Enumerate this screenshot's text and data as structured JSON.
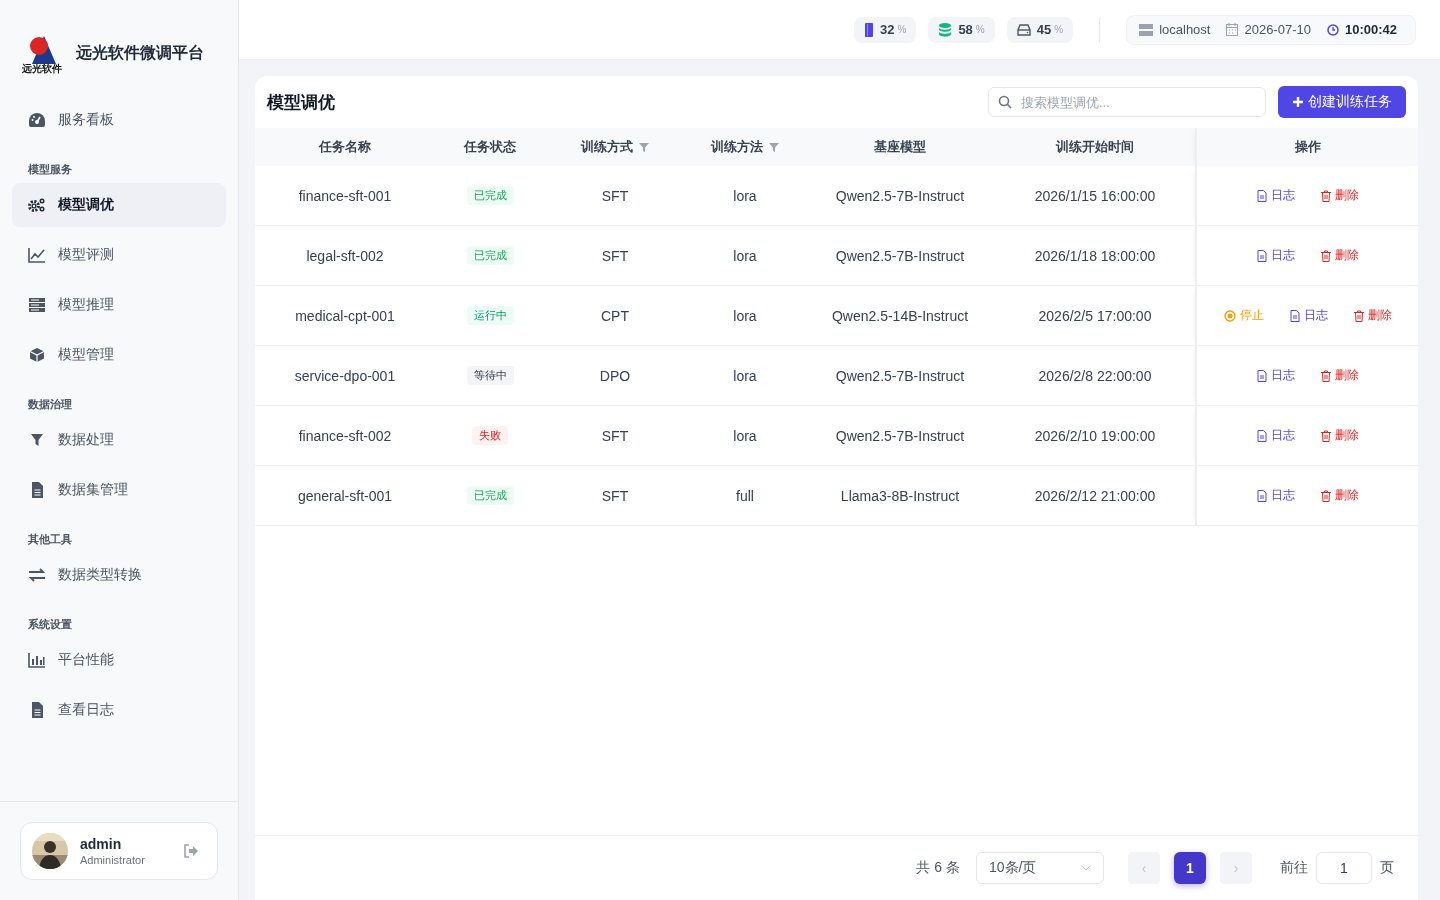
{
  "sidebar": {
    "logo_text": "远光软件",
    "title": "远光软件微调平台",
    "nav": [
      {
        "kind": "item",
        "label": "服务看板",
        "selected": false
      },
      {
        "kind": "heading",
        "label": "模型服务"
      },
      {
        "kind": "item",
        "label": "模型调优",
        "selected": true
      },
      {
        "kind": "item",
        "label": "模型评测",
        "selected": false
      },
      {
        "kind": "item",
        "label": "模型推理",
        "selected": false
      },
      {
        "kind": "item",
        "label": "模型管理",
        "selected": false
      },
      {
        "kind": "heading",
        "label": "数据治理"
      },
      {
        "kind": "item",
        "label": "数据处理",
        "selected": false
      },
      {
        "kind": "item",
        "label": "数据集管理",
        "selected": false
      },
      {
        "kind": "heading",
        "label": "其他工具"
      },
      {
        "kind": "item",
        "label": "数据类型转换",
        "selected": false
      },
      {
        "kind": "heading",
        "label": "系统设置"
      },
      {
        "kind": "item",
        "label": "平台性能",
        "selected": false
      },
      {
        "kind": "item",
        "label": "查看日志",
        "selected": false
      }
    ],
    "user": {
      "name": "admin",
      "role": "Administrator"
    }
  },
  "topbar": {
    "stats": [
      {
        "value": "32",
        "unit": "%"
      },
      {
        "value": "58",
        "unit": "%"
      },
      {
        "value": "45",
        "unit": "%"
      }
    ],
    "host": "localhost",
    "date": "2026-07-10",
    "time": "10:00:42"
  },
  "main": {
    "title": "模型调优",
    "search": {
      "placeholder": "搜索模型调优..."
    },
    "create_button": "创建训练任务",
    "table": {
      "columns": [
        {
          "label": "任务名称",
          "filter": false
        },
        {
          "label": "任务状态",
          "filter": false
        },
        {
          "label": "训练方式",
          "filter": true
        },
        {
          "label": "训练方法",
          "filter": true
        },
        {
          "label": "基座模型",
          "filter": false
        },
        {
          "label": "训练开始时间",
          "filter": false
        },
        {
          "label": "操作",
          "filter": false
        }
      ],
      "rows": [
        {
          "name": "finance-sft-001",
          "status": {
            "text": "已完成",
            "kind": "done"
          },
          "mode": "SFT",
          "method": "lora",
          "model": "Qwen2.5-7B-Instruct",
          "start": "2026/1/15 16:00:00",
          "actions": [
            {
              "kind": "log",
              "label": "日志"
            },
            {
              "kind": "delete",
              "label": "删除"
            }
          ]
        },
        {
          "name": "legal-sft-002",
          "status": {
            "text": "已完成",
            "kind": "done"
          },
          "mode": "SFT",
          "method": "lora",
          "model": "Qwen2.5-7B-Instruct",
          "start": "2026/1/18 18:00:00",
          "actions": [
            {
              "kind": "log",
              "label": "日志"
            },
            {
              "kind": "delete",
              "label": "删除"
            }
          ]
        },
        {
          "name": "medical-cpt-001",
          "status": {
            "text": "运行中",
            "kind": "running"
          },
          "mode": "CPT",
          "method": "lora",
          "model": "Qwen2.5-14B-Instruct",
          "start": "2026/2/5 17:00:00",
          "actions": [
            {
              "kind": "stop",
              "label": "停止"
            },
            {
              "kind": "log",
              "label": "日志"
            },
            {
              "kind": "delete",
              "label": "删除"
            }
          ]
        },
        {
          "name": "service-dpo-001",
          "status": {
            "text": "等待中",
            "kind": "waiting"
          },
          "mode": "DPO",
          "method": "lora",
          "model": "Qwen2.5-7B-Instruct",
          "start": "2026/2/8 22:00:00",
          "actions": [
            {
              "kind": "log",
              "label": "日志"
            },
            {
              "kind": "delete",
              "label": "删除"
            }
          ]
        },
        {
          "name": "finance-sft-002",
          "status": {
            "text": "失败",
            "kind": "failed"
          },
          "mode": "SFT",
          "method": "lora",
          "model": "Qwen2.5-7B-Instruct",
          "start": "2026/2/10 19:00:00",
          "actions": [
            {
              "kind": "log",
              "label": "日志"
            },
            {
              "kind": "delete",
              "label": "删除"
            }
          ]
        },
        {
          "name": "general-sft-001",
          "status": {
            "text": "已完成",
            "kind": "done"
          },
          "mode": "SFT",
          "method": "full",
          "model": "Llama3-8B-Instruct",
          "start": "2026/2/12 21:00:00",
          "actions": [
            {
              "kind": "log",
              "label": "日志"
            },
            {
              "kind": "delete",
              "label": "删除"
            }
          ]
        }
      ]
    },
    "pagination": {
      "total": "共 6 条",
      "page_size": "10条/页",
      "prev": "‹",
      "pages": [
        {
          "label": "1",
          "selected": true
        }
      ],
      "next": "›",
      "goto_label": "前往",
      "goto_value": "1",
      "suffix": "页"
    }
  }
}
